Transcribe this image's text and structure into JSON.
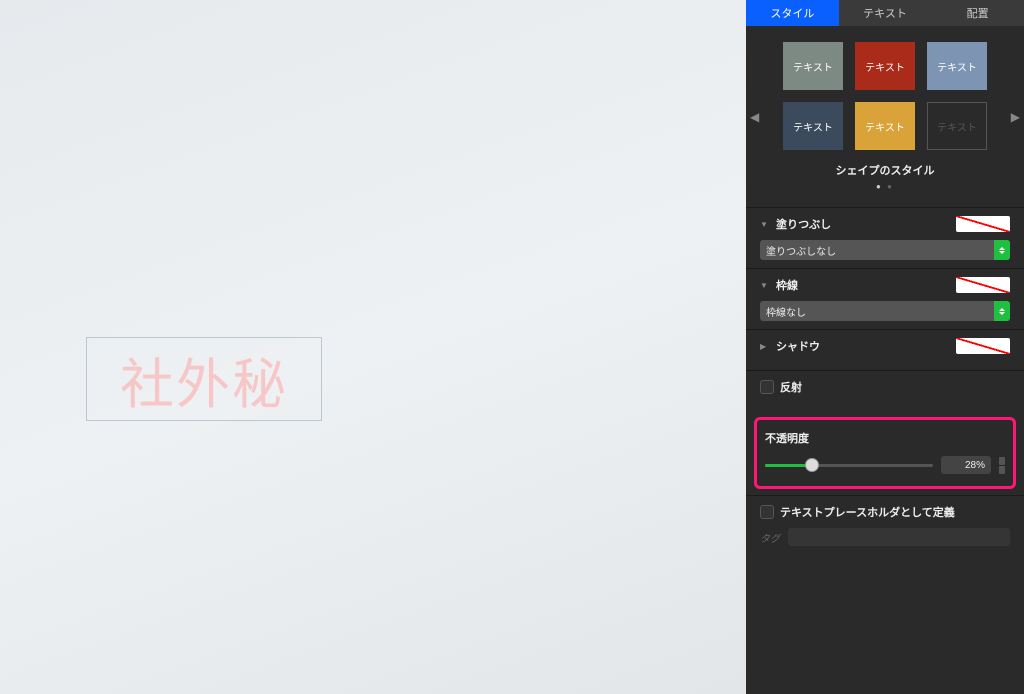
{
  "canvas": {
    "text": "社外秘"
  },
  "tabs": {
    "style": "スタイル",
    "text": "テキスト",
    "arrange": "配置"
  },
  "swatches": {
    "label": "テキスト",
    "colors": [
      "#7d8a84",
      "#ab2b1b",
      "#7d95b2",
      "#3c4a5e",
      "#d9a33a"
    ],
    "title": "シェイプのスタイル"
  },
  "fill": {
    "label": "塗りつぶし",
    "option": "塗りつぶしなし"
  },
  "border": {
    "label": "枠線",
    "option": "枠線なし"
  },
  "shadow": {
    "label": "シャドウ"
  },
  "reflect": {
    "label": "反射"
  },
  "opacity": {
    "label": "不透明度",
    "value": "28%",
    "percent": 28
  },
  "placeholder": {
    "label": "テキストプレースホルダとして定義",
    "tag": "タグ"
  }
}
